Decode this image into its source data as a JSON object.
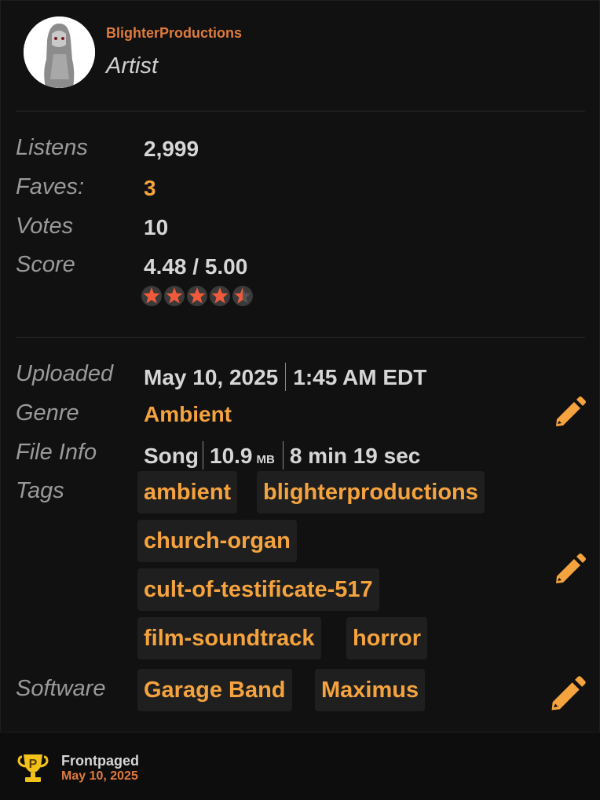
{
  "artist": {
    "name": "BlighterProductions",
    "role": "Artist"
  },
  "stats": {
    "listens_label": "Listens",
    "listens": "2,999",
    "faves_label": "Faves:",
    "faves": "3",
    "votes_label": "Votes",
    "votes": "10",
    "score_label": "Score",
    "score": "4.48 / 5.00",
    "rating_stars": 4.5
  },
  "info": {
    "uploaded_label": "Uploaded",
    "uploaded_date": "May 10, 2025",
    "uploaded_time": "1:45 AM EDT",
    "genre_label": "Genre",
    "genre": "Ambient",
    "fileinfo_label": "File Info",
    "file_type": "Song",
    "file_size": "10.9",
    "file_size_unit": "MB",
    "duration": "8 min 19 sec",
    "tags_label": "Tags",
    "tags": [
      "ambient",
      "blighterproductions",
      "church-organ",
      "cult-of-testificate-517",
      "film-soundtrack",
      "horror"
    ],
    "software_label": "Software",
    "software": [
      "Garage Band",
      "Maximus"
    ]
  },
  "footer": {
    "title": "Frontpaged",
    "date": "May 10, 2025"
  },
  "colors": {
    "accent": "#f5a33e",
    "name": "#e07b3c",
    "star": "#ef5a3c"
  },
  "icons": {
    "edit": "pencil-icon",
    "trophy": "frontpage-trophy-icon"
  }
}
